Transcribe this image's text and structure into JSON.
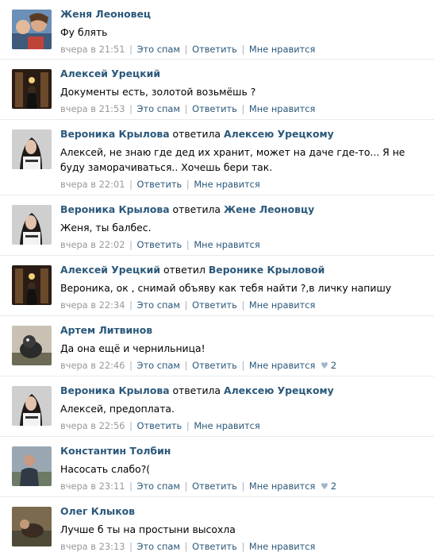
{
  "comments": [
    {
      "author": "Женя Леоновец",
      "verb": "",
      "reply_to": "",
      "text": "Фу блять",
      "time": "вчера в 21:51",
      "actions": [
        "Это спам",
        "Ответить",
        "Мне нравится"
      ],
      "likes": ""
    },
    {
      "author": "Алексей Урецкий",
      "verb": "",
      "reply_to": "",
      "text": "Документы есть, золотой возьмёшь ?",
      "time": "вчера в 21:53",
      "actions": [
        "Это спам",
        "Ответить",
        "Мне нравится"
      ],
      "likes": ""
    },
    {
      "author": "Вероника Крылова",
      "verb": "ответила",
      "reply_to": "Алексею Урецкому",
      "text": "Алексей, не знаю где дед их хранит,  может на даче где-то... Я не буду заморачиваться.. Хочешь бери так.",
      "time": "вчера в 22:01",
      "actions": [
        "Ответить",
        "Мне нравится"
      ],
      "likes": ""
    },
    {
      "author": "Вероника Крылова",
      "verb": "ответила",
      "reply_to": "Жене Леоновцу",
      "text": "Женя, ты балбес.",
      "time": "вчера в 22:02",
      "actions": [
        "Ответить",
        "Мне нравится"
      ],
      "likes": ""
    },
    {
      "author": "Алексей Урецкий",
      "verb": "ответил",
      "reply_to": "Веронике Крыловой",
      "text": "Вероника, ок , снимай объяву как тебя найти ?,в личку напишу",
      "time": "вчера в 22:34",
      "actions": [
        "Это спам",
        "Ответить",
        "Мне нравится"
      ],
      "likes": ""
    },
    {
      "author": "Артем Литвинов",
      "verb": "",
      "reply_to": "",
      "text": "Да она ещё и чернильница!",
      "time": "вчера в 22:46",
      "actions": [
        "Это спам",
        "Ответить",
        "Мне нравится"
      ],
      "likes": "2"
    },
    {
      "author": "Вероника Крылова",
      "verb": "ответила",
      "reply_to": "Алексею Урецкому",
      "text": "Алексей, предоплата.",
      "time": "вчера в 22:56",
      "actions": [
        "Ответить",
        "Мне нравится"
      ],
      "likes": ""
    },
    {
      "author": "Константин Толбин",
      "verb": "",
      "reply_to": "",
      "text": "Насосать слабо?(",
      "time": "вчера в 23:11",
      "actions": [
        "Это спам",
        "Ответить",
        "Мне нравится"
      ],
      "likes": "2"
    },
    {
      "author": "Олег Клыков",
      "verb": "",
      "reply_to": "",
      "text": "Лучше б ты на простыни высохла",
      "time": "вчера в 23:13",
      "actions": [
        "Это спам",
        "Ответить",
        "Мне нравится"
      ],
      "likes": ""
    }
  ]
}
